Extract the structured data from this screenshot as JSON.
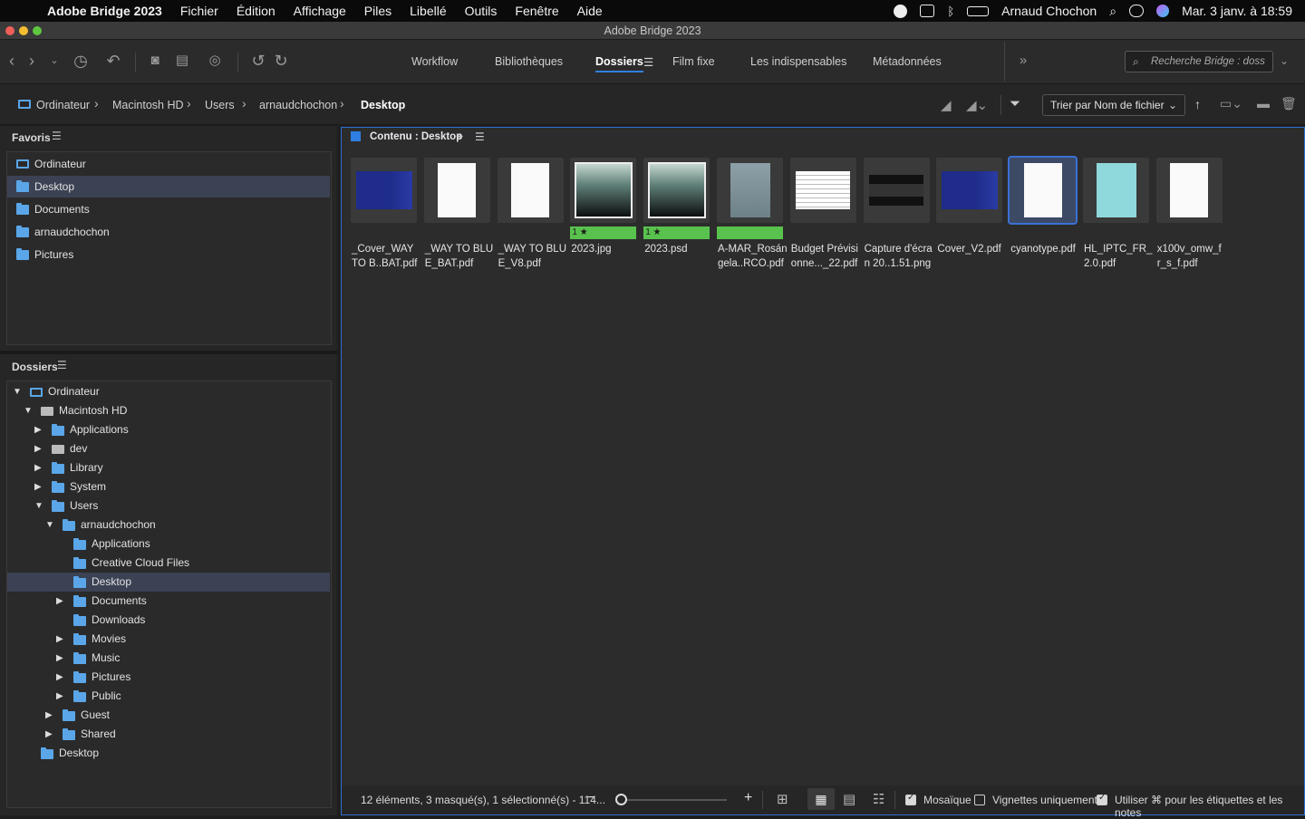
{
  "menubar": {
    "app_name": "Adobe Bridge 2023",
    "items": [
      "Fichier",
      "Édition",
      "Affichage",
      "Piles",
      "Libellé",
      "Outils",
      "Fenêtre",
      "Aide"
    ],
    "user": "Arnaud Chochon",
    "datetime": "Mar. 3 janv. à  18:59"
  },
  "window": {
    "title": "Adobe Bridge 2023"
  },
  "workspace_tabs": [
    "Workflow",
    "Bibliothèques",
    "Dossiers",
    "Film fixe",
    "Les indispensables",
    "Métadonnées"
  ],
  "active_workspace": "Dossiers",
  "search": {
    "placeholder": "Recherche Bridge : doss"
  },
  "breadcrumb": [
    "Ordinateur",
    "Macintosh HD",
    "Users",
    "arnaudchochon",
    "Desktop"
  ],
  "sort": {
    "label": "Trier par Nom de fichier"
  },
  "favorites": {
    "title": "Favoris",
    "items": [
      "Ordinateur",
      "Desktop",
      "Documents",
      "arnaudchochon",
      "Pictures"
    ],
    "selected": "Desktop"
  },
  "folders": {
    "title": "Dossiers",
    "tree": [
      {
        "label": "Ordinateur",
        "level": 0,
        "state": "open",
        "icon": "computer"
      },
      {
        "label": "Macintosh HD",
        "level": 1,
        "state": "open",
        "icon": "disk"
      },
      {
        "label": "Applications",
        "level": 2,
        "state": "closed",
        "icon": "folder"
      },
      {
        "label": "dev",
        "level": 2,
        "state": "closed",
        "icon": "disk"
      },
      {
        "label": "Library",
        "level": 2,
        "state": "closed",
        "icon": "folder"
      },
      {
        "label": "System",
        "level": 2,
        "state": "closed",
        "icon": "folder"
      },
      {
        "label": "Users",
        "level": 2,
        "state": "open",
        "icon": "folder"
      },
      {
        "label": "arnaudchochon",
        "level": 3,
        "state": "open",
        "icon": "folder"
      },
      {
        "label": "Applications",
        "level": 4,
        "state": "none",
        "icon": "folder"
      },
      {
        "label": "Creative Cloud Files",
        "level": 4,
        "state": "none",
        "icon": "folder"
      },
      {
        "label": "Desktop",
        "level": 4,
        "state": "none",
        "icon": "folder",
        "selected": true
      },
      {
        "label": "Documents",
        "level": 4,
        "state": "closed",
        "icon": "folder"
      },
      {
        "label": "Downloads",
        "level": 4,
        "state": "none",
        "icon": "folder"
      },
      {
        "label": "Movies",
        "level": 4,
        "state": "closed",
        "icon": "folder"
      },
      {
        "label": "Music",
        "level": 4,
        "state": "closed",
        "icon": "folder"
      },
      {
        "label": "Pictures",
        "level": 4,
        "state": "closed",
        "icon": "folder"
      },
      {
        "label": "Public",
        "level": 4,
        "state": "closed",
        "icon": "folder"
      },
      {
        "label": "Guest",
        "level": 3,
        "state": "closed",
        "icon": "folder"
      },
      {
        "label": "Shared",
        "level": 3,
        "state": "closed",
        "icon": "folder"
      },
      {
        "label": "Desktop",
        "level": 1,
        "state": "none",
        "icon": "folder"
      }
    ]
  },
  "content": {
    "title": "Contenu : Desktop",
    "files": [
      {
        "line1": "_Cover_WAY",
        "line2": "TO B..BAT.pdf",
        "kind": "blue",
        "rating": null
      },
      {
        "line1": "_WAY TO BLU",
        "line2": "E_BAT.pdf",
        "kind": "doc",
        "rating": null
      },
      {
        "line1": "_WAY TO BLU",
        "line2": "E_V8.pdf",
        "kind": "doc",
        "rating": null
      },
      {
        "line1": "2023.jpg",
        "line2": "",
        "kind": "photo",
        "rating": "1"
      },
      {
        "line1": "2023.psd",
        "line2": "",
        "kind": "photo",
        "rating": "1"
      },
      {
        "line1": "A-MAR_Rosán",
        "line2": "gela..RCO.pdf",
        "kind": "gray",
        "rating": ""
      },
      {
        "line1": "Budget Prévisi",
        "line2": "onne..._22.pdf",
        "kind": "sheet",
        "rating": null
      },
      {
        "line1": "Capture d'écra",
        "line2": "n 20..1.51.png",
        "kind": "screen",
        "rating": null
      },
      {
        "line1": "Cover_V2.pdf",
        "line2": "",
        "kind": "blue",
        "rating": null
      },
      {
        "line1": "cyanotype.pdf",
        "line2": "",
        "kind": "doc2",
        "rating": null,
        "selected": true
      },
      {
        "line1": "HL_IPTC_FR_",
        "line2": "2.0.pdf",
        "kind": "teal",
        "rating": null
      },
      {
        "line1": "x100v_omw_f",
        "line2": "r_s_f.pdf",
        "kind": "doc",
        "rating": null
      }
    ]
  },
  "footer": {
    "status": "12 éléments,  3 masqué(s), 1 sélectionné(s) - 114...",
    "mosaic_label": "Mosaïque",
    "thumbs_only_label": "Vignettes uniquement",
    "cmd_label": "Utiliser ⌘ pour les étiquettes et les notes"
  },
  "colors": {
    "accent": "#2f7fe0",
    "selection": "#3b4254",
    "rating_green": "#59c24e",
    "folder_blue": "#5aa6e8"
  }
}
